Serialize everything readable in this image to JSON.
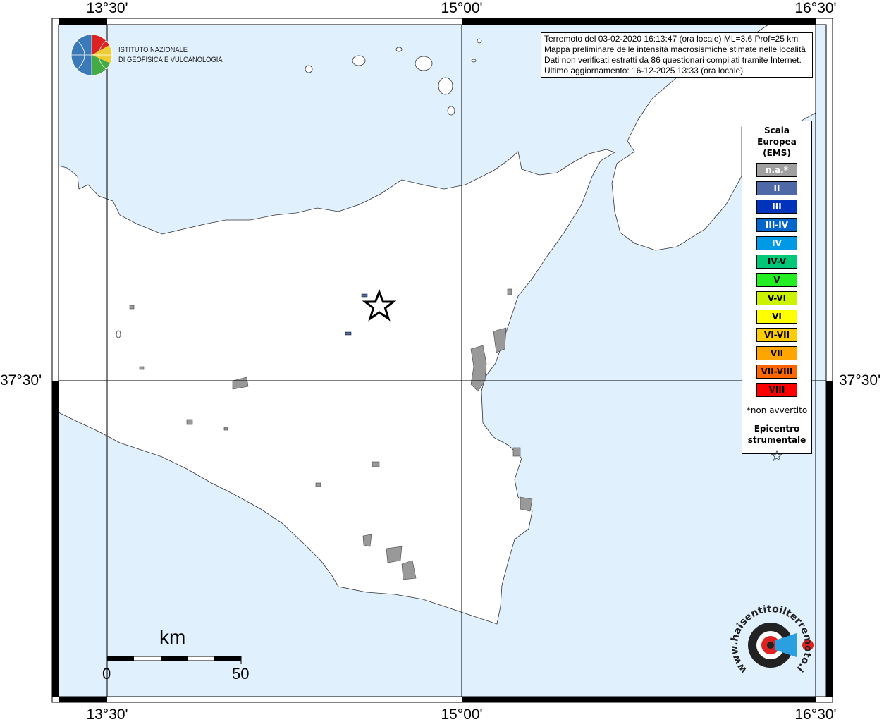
{
  "axes": {
    "lon_labels": [
      "13°30'",
      "15°00'",
      "16°30'"
    ],
    "lat_labels": [
      "37°30'"
    ]
  },
  "info_box": {
    "lines": [
      "Terremoto del 03-02-2020 16:13:47 (ora locale) ML=3.6 Prof=25 km",
      "Mappa preliminare delle intensità macrosismiche stimate nelle località",
      "Dati non verificati estratti da 86 questionari compilati tramite Internet.",
      "Ultimo aggiornamento: 16-12-2025 13:33 (ora locale)"
    ]
  },
  "logo": {
    "line1": "ISTITUTO NAZIONALE",
    "line2": "DI GEOFISICA E VULCANOLOGIA"
  },
  "legend": {
    "title": [
      "Scala",
      "Europea",
      "(EMS)"
    ],
    "items": [
      {
        "label": "n.a.*",
        "color": "#a0a0a0",
        "text": "#ffffff"
      },
      {
        "label": "II",
        "color": "#4f68a8",
        "text": "#ffffff"
      },
      {
        "label": "III",
        "color": "#0033bb",
        "text": "#ffffff"
      },
      {
        "label": "III-IV",
        "color": "#0066cc",
        "text": "#ffffff"
      },
      {
        "label": "IV",
        "color": "#0099e6",
        "text": "#ffffff"
      },
      {
        "label": "IV-V",
        "color": "#00c878",
        "text": "#000000"
      },
      {
        "label": "V",
        "color": "#22ee22",
        "text": "#000000"
      },
      {
        "label": "V-VI",
        "color": "#ccf200",
        "text": "#000000"
      },
      {
        "label": "VI",
        "color": "#ffff00",
        "text": "#000000"
      },
      {
        "label": "VI-VII",
        "color": "#ffcc00",
        "text": "#000000"
      },
      {
        "label": "VII",
        "color": "#ffa500",
        "text": "#000000"
      },
      {
        "label": "VII-VIII",
        "color": "#ff6600",
        "text": "#000000"
      },
      {
        "label": "VIII",
        "color": "#ff0000",
        "text": "#000000"
      }
    ],
    "note": "*non avvertito",
    "epicenter": [
      "Epicentro",
      "strumentale"
    ]
  },
  "scale_bar": {
    "unit": "km",
    "min": "0",
    "max": "50"
  },
  "watermark": "www.haisentitoilterremoto.it",
  "colors": {
    "sea": "#e0f0fc",
    "land": "#ffffff",
    "urban": "#999999"
  }
}
